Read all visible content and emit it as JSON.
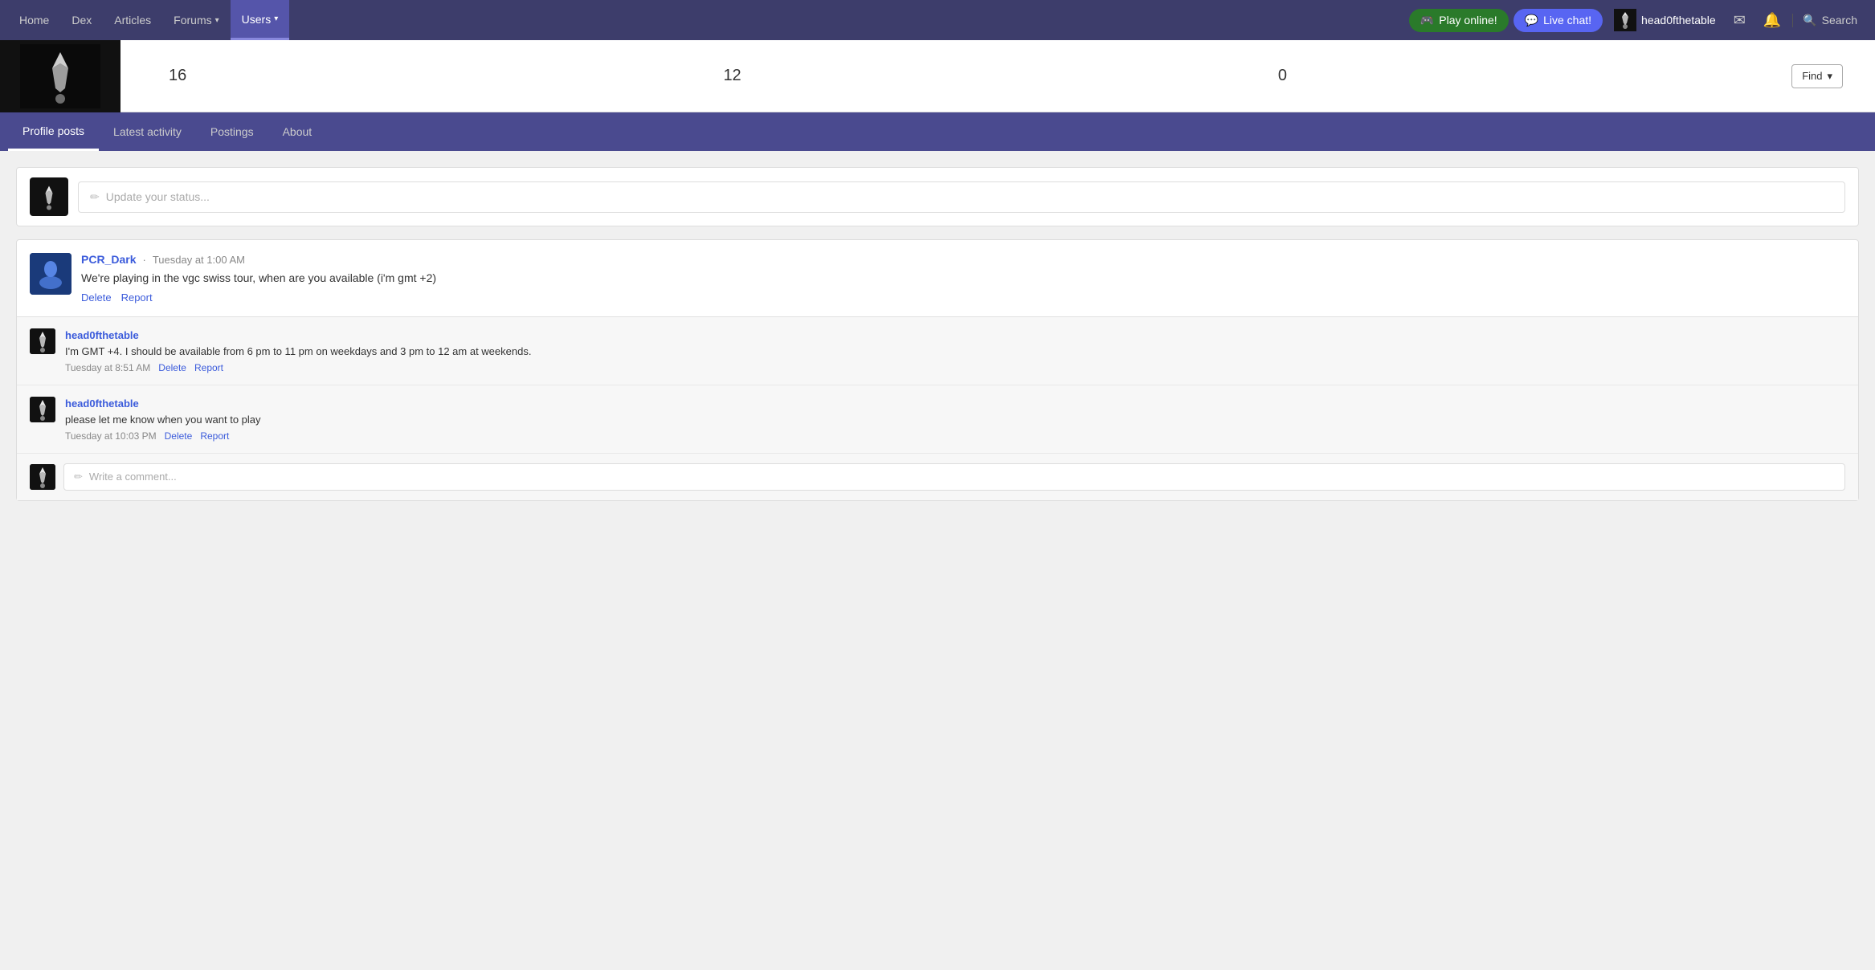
{
  "nav": {
    "items": [
      {
        "label": "Home",
        "active": false
      },
      {
        "label": "Dex",
        "active": false
      },
      {
        "label": "Articles",
        "active": false
      },
      {
        "label": "Forums",
        "active": false,
        "hasDropdown": true
      },
      {
        "label": "Users",
        "active": true,
        "hasDropdown": true
      }
    ],
    "play_label": "Play online!",
    "chat_label": "Live chat!",
    "username": "head0fthetable",
    "search_label": "Search"
  },
  "stats": {
    "stat1": "16",
    "stat2": "12",
    "stat3": "0",
    "find_label": "Find"
  },
  "tabs": [
    {
      "label": "Profile posts",
      "active": true
    },
    {
      "label": "Latest activity",
      "active": false
    },
    {
      "label": "Postings",
      "active": false
    },
    {
      "label": "About",
      "active": false
    }
  ],
  "status_placeholder": "Update your status...",
  "post": {
    "author": "PCR_Dark",
    "timestamp": "Tuesday at 1:00 AM",
    "text": "We're playing in the vgc swiss tour, when are you available (i'm gmt +2)",
    "delete_label": "Delete",
    "report_label": "Report",
    "replies": [
      {
        "author": "head0fthetable",
        "text": "I'm GMT +4. I should be available from 6 pm to 11 pm on weekdays and 3 pm to 12 am at weekends.",
        "timestamp": "Tuesday at 8:51 AM",
        "delete_label": "Delete",
        "report_label": "Report"
      },
      {
        "author": "head0fthetable",
        "text": "please let me know when you want to play",
        "timestamp": "Tuesday at 10:03 PM",
        "delete_label": "Delete",
        "report_label": "Report"
      }
    ],
    "comment_placeholder": "Write a comment..."
  }
}
